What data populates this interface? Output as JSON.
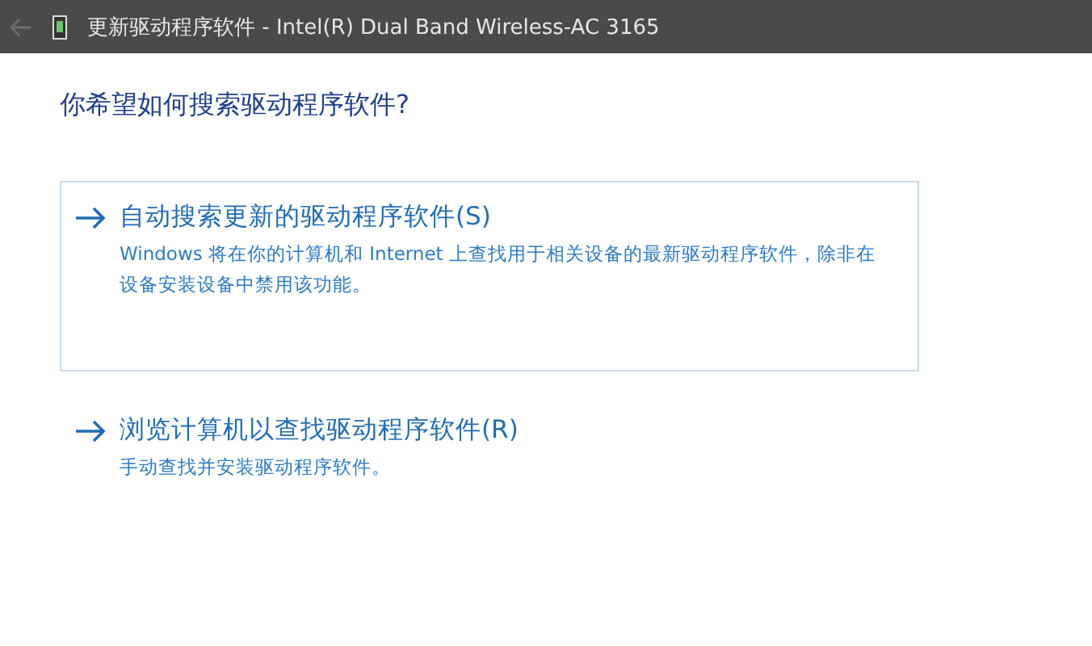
{
  "window": {
    "title": "更新驱动程序软件 - Intel(R) Dual Band Wireless-AC 3165"
  },
  "heading": "你希望如何搜索驱动程序软件?",
  "options": [
    {
      "title": "自动搜索更新的驱动程序软件(S)",
      "description": "Windows 将在你的计算机和 Internet 上查找用于相关设备的最新驱动程序软件，除非在设备安装设备中禁用该功能。",
      "selected": true
    },
    {
      "title": "浏览计算机以查找驱动程序软件(R)",
      "description": "手动查找并安装驱动程序软件。",
      "selected": false
    }
  ]
}
